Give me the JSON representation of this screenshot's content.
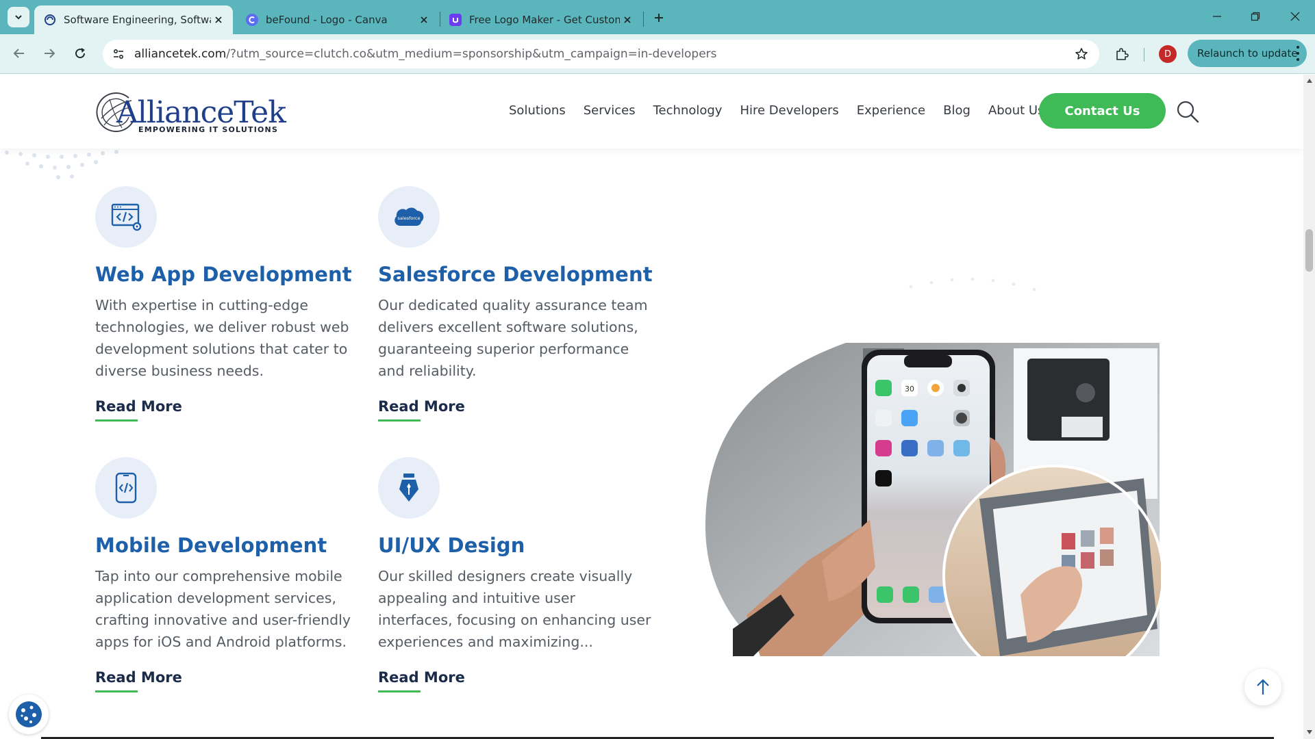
{
  "browser": {
    "tabs": [
      {
        "title": "Software Engineering, Software",
        "active": true
      },
      {
        "title": "beFound - Logo - Canva",
        "active": false
      },
      {
        "title": "Free Logo Maker - Get Custom",
        "active": false
      }
    ],
    "url_host": "alliancetek.com",
    "url_rest": "/?utm_source=clutch.co&utm_medium=sponsorship&utm_campaign=in-developers",
    "profile_initial": "D",
    "relaunch_label": "Relaunch to update"
  },
  "site": {
    "logo_word": "AllianceTek",
    "logo_tagline": "EMPOWERING IT SOLUTIONS",
    "nav": [
      "Solutions",
      "Services",
      "Technology",
      "Hire Developers",
      "Experience",
      "Blog",
      "About Us"
    ],
    "contact_label": "Contact Us"
  },
  "services": [
    {
      "icon": "web-code-icon",
      "title": "Web App Development",
      "desc": "With expertise in cutting-edge technologies, we deliver robust web development solutions that cater to diverse business needs.",
      "link": "Read More"
    },
    {
      "icon": "salesforce-cloud-icon",
      "icon_text": "salesforce",
      "title": "Salesforce Development",
      "desc": "Our dedicated quality assurance team delivers excellent software solutions, guaranteeing superior performance and reliability.",
      "link": "Read More"
    },
    {
      "icon": "mobile-code-icon",
      "title": "Mobile Development",
      "desc": "Tap into our comprehensive mobile application development services, crafting innovative and user-friendly apps for iOS and Android platforms.",
      "link": "Read More"
    },
    {
      "icon": "pen-nib-icon",
      "title": "UI/UX Design",
      "desc": "Our skilled designers create visually appealing and intuitive user interfaces, focusing on enhancing user experiences and maximizing...",
      "link": "Read More"
    }
  ],
  "phone_calendar_day": "30",
  "colors": {
    "accent_green": "#3fba57",
    "title_blue": "#1d5fa8",
    "chrome_teal": "#5ab6bc"
  }
}
